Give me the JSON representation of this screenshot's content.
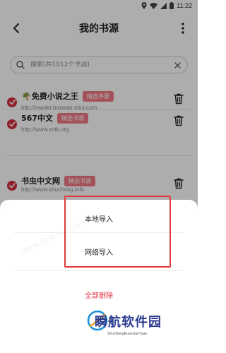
{
  "status_bar": {
    "time": "11:22"
  },
  "header": {
    "title": "我的书源"
  },
  "search": {
    "placeholder": "搜索(共1012个书源)"
  },
  "sources": [
    {
      "name": "免费小说之王",
      "tag": "精选书源",
      "url": "http://reader.browser.miui.com",
      "checked": true,
      "has_palm_icon": true
    },
    {
      "name": "567中文",
      "tag": "精选书源",
      "url": "http://www.xntk.org",
      "checked": true,
      "has_palm_icon": false
    },
    {
      "name": "书虫中文网",
      "tag": "精选书源",
      "url": "http://www.shuchong.info",
      "checked": true,
      "has_palm_icon": false
    }
  ],
  "sheet": {
    "local_import": "本地导入",
    "network_import": "网络导入",
    "delete_all": "全部删除"
  },
  "watermark": "www.downcc.com",
  "logo": {
    "text": "瞬航软件园",
    "sub": "ShunHangRuanJianYuan"
  },
  "colors": {
    "accent": "#d3303d",
    "tag_bg": "#f27a83",
    "highlight": "#e23a3a",
    "delete_text": "#e0343f"
  }
}
